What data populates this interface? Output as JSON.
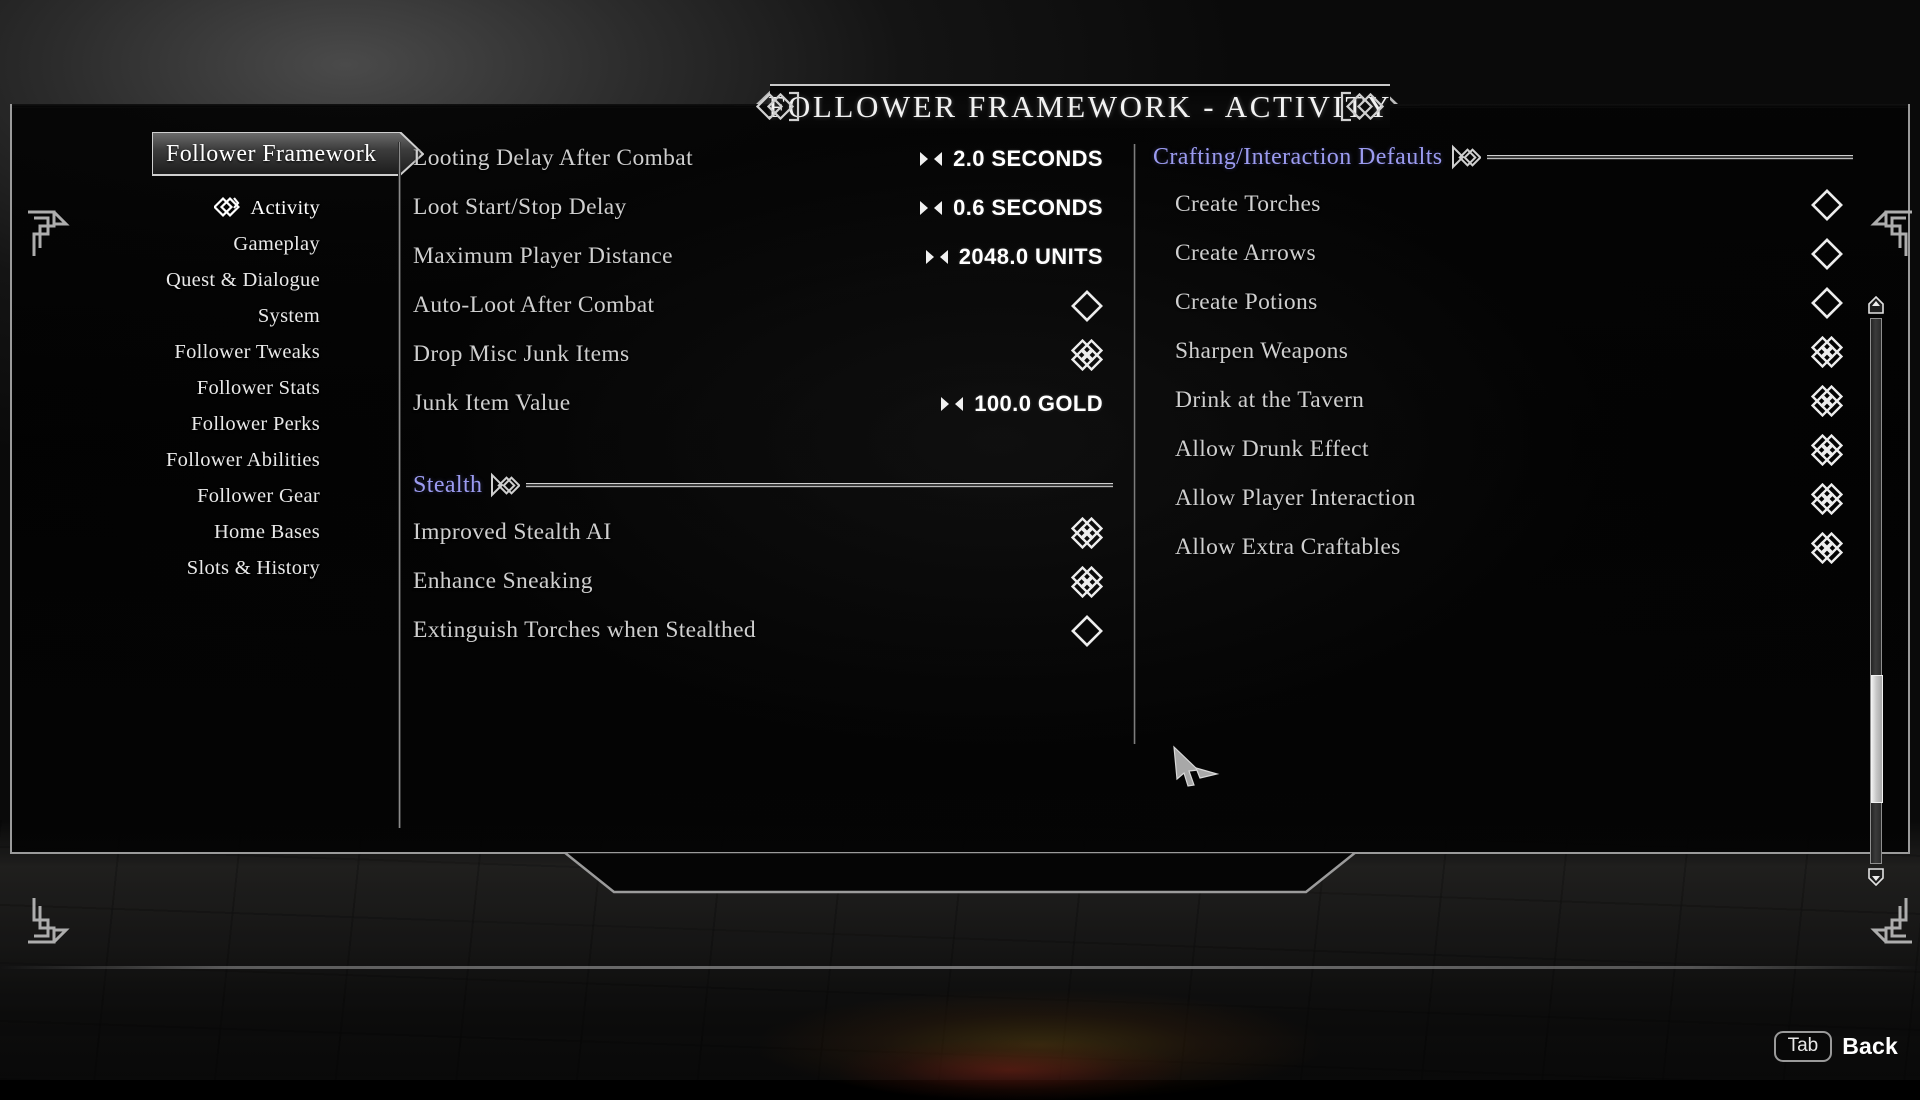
{
  "window": {
    "title": "FOLLOWER FRAMEWORK - ACTIVITY"
  },
  "sidebar": {
    "module_name": "Follower Framework",
    "items": [
      {
        "label": "Activity",
        "selected": true,
        "bullet": "knot-bullet-icon"
      },
      {
        "label": "Gameplay",
        "selected": false,
        "bullet": ""
      },
      {
        "label": "Quest & Dialogue",
        "selected": false,
        "bullet": ""
      },
      {
        "label": "System",
        "selected": false,
        "bullet": ""
      },
      {
        "label": "Follower Tweaks",
        "selected": false,
        "bullet": ""
      },
      {
        "label": "Follower Stats",
        "selected": false,
        "bullet": ""
      },
      {
        "label": "Follower Perks",
        "selected": false,
        "bullet": ""
      },
      {
        "label": "Follower Abilities",
        "selected": false,
        "bullet": ""
      },
      {
        "label": "Follower Gear",
        "selected": false,
        "bullet": ""
      },
      {
        "label": "Home Bases",
        "selected": false,
        "bullet": ""
      },
      {
        "label": "Slots & History",
        "selected": false,
        "bullet": ""
      }
    ]
  },
  "left_column": {
    "rows": [
      {
        "label": "Looting Delay After Combat",
        "type": "slider",
        "value": "2.0 SECONDS"
      },
      {
        "label": "Loot Start/Stop Delay",
        "type": "slider",
        "value": "0.6 SECONDS"
      },
      {
        "label": "Maximum Player Distance",
        "type": "slider",
        "value": "2048.0 UNITS"
      },
      {
        "label": "Auto-Loot After Combat",
        "type": "checkbox",
        "checked": false
      },
      {
        "label": "Drop Misc Junk Items",
        "type": "checkbox",
        "checked": true
      },
      {
        "label": "Junk Item Value",
        "type": "slider",
        "value": "100.0 GOLD"
      }
    ],
    "section": {
      "title": "Stealth",
      "rows": [
        {
          "label": "Improved Stealth AI",
          "type": "checkbox",
          "checked": true
        },
        {
          "label": "Enhance Sneaking",
          "type": "checkbox",
          "checked": true
        },
        {
          "label": "Extinguish Torches when Stealthed",
          "type": "checkbox",
          "checked": false
        }
      ]
    }
  },
  "right_column": {
    "section": {
      "title": "Crafting/Interaction Defaults",
      "rows": [
        {
          "label": "Create Torches",
          "type": "checkbox",
          "checked": false
        },
        {
          "label": "Create Arrows",
          "type": "checkbox",
          "checked": false
        },
        {
          "label": "Create Potions",
          "type": "checkbox",
          "checked": false
        },
        {
          "label": "Sharpen Weapons",
          "type": "checkbox",
          "checked": true
        },
        {
          "label": "Drink at the Tavern",
          "type": "checkbox",
          "checked": true
        },
        {
          "label": "Allow Drunk Effect",
          "type": "checkbox",
          "checked": true
        },
        {
          "label": "Allow Player Interaction",
          "type": "checkbox",
          "checked": true
        },
        {
          "label": "Allow Extra Craftables",
          "type": "checkbox",
          "checked": true
        }
      ]
    }
  },
  "footer": {
    "key": "Tab",
    "action": "Back"
  },
  "colors": {
    "section_header": "#9b9bf0",
    "label": "#cfcfcf",
    "value": "#ffffff",
    "frame": "#9b9b9b"
  }
}
